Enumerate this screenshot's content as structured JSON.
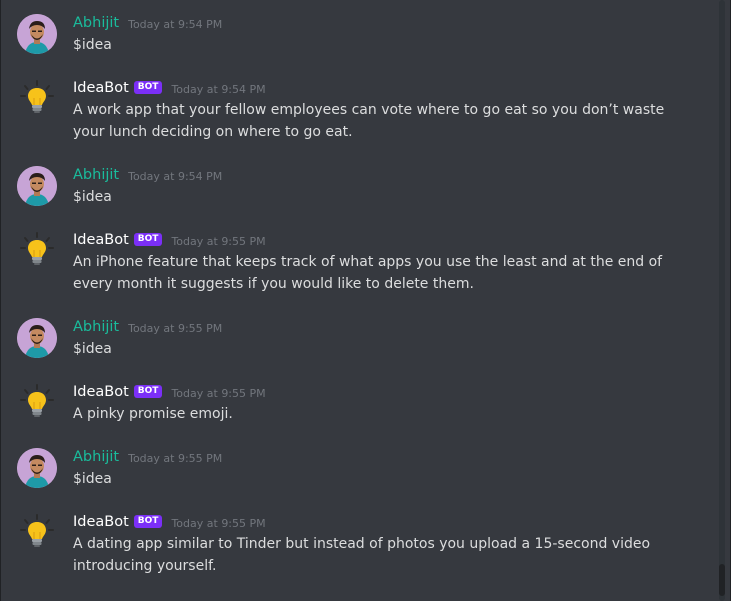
{
  "messages": [
    {
      "author": "Abhijit",
      "is_bot": false,
      "timestamp": "Today at 9:54 PM",
      "text": "$idea"
    },
    {
      "author": "IdeaBot",
      "is_bot": true,
      "bot_tag": "BOT",
      "timestamp": "Today at 9:54 PM",
      "text": "A work app that your fellow employees can vote where to go eat so you don’t waste your lunch deciding on where to go eat."
    },
    {
      "author": "Abhijit",
      "is_bot": false,
      "timestamp": "Today at 9:54 PM",
      "text": "$idea"
    },
    {
      "author": "IdeaBot",
      "is_bot": true,
      "bot_tag": "BOT",
      "timestamp": "Today at 9:55 PM",
      "text": "An iPhone feature that keeps track of what apps you use the least and at the end of every month it suggests if you would like to delete them."
    },
    {
      "author": "Abhijit",
      "is_bot": false,
      "timestamp": "Today at 9:55 PM",
      "text": "$idea"
    },
    {
      "author": "IdeaBot",
      "is_bot": true,
      "bot_tag": "BOT",
      "timestamp": "Today at 9:55 PM",
      "text": "A pinky promise emoji."
    },
    {
      "author": "Abhijit",
      "is_bot": false,
      "timestamp": "Today at 9:55 PM",
      "text": "$idea"
    },
    {
      "author": "IdeaBot",
      "is_bot": true,
      "bot_tag": "BOT",
      "timestamp": "Today at 9:55 PM",
      "text": "A dating app similar to Tinder but instead of photos you upload a 15-second video introducing yourself."
    }
  ],
  "colors": {
    "background": "#36393f",
    "user_name": "#1abc9c",
    "bot_name": "#ffffff",
    "bot_tag": "#7b2ff7",
    "text": "#dcddde",
    "timestamp": "#72767d"
  },
  "icons": {
    "user_avatar": "user-avatar-icon",
    "bot_avatar": "lightbulb-icon"
  }
}
